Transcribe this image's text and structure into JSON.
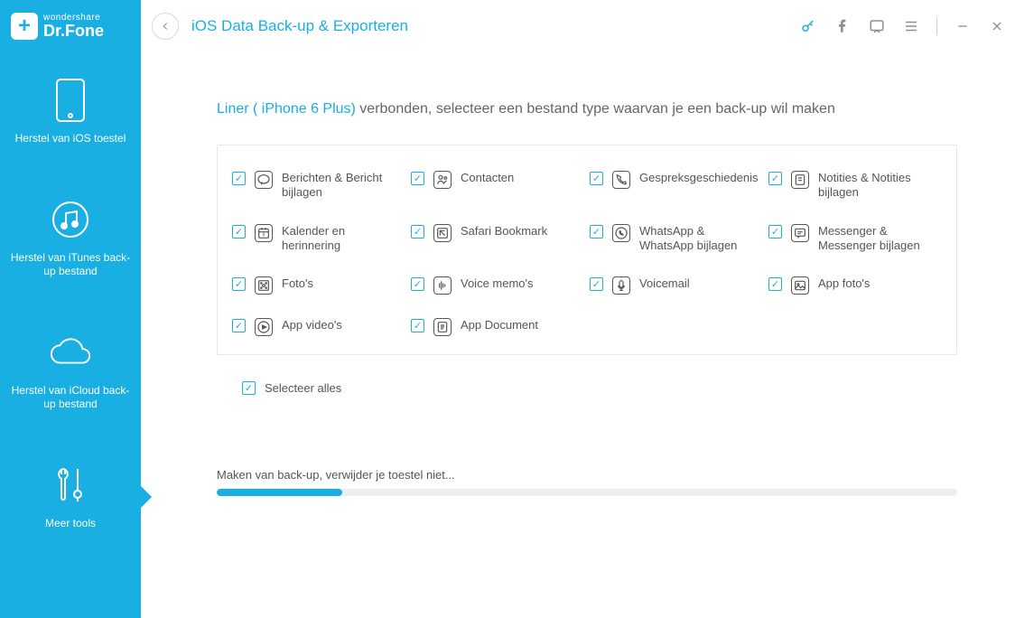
{
  "brand": {
    "top": "wondershare",
    "bottom": "Dr.Fone"
  },
  "page_title": "iOS Data Back-up & Exporteren",
  "device_name": "Liner ( iPhone 6 Plus)",
  "description_suffix": " verbonden, selecteer een bestand type waarvan je een back-up wil maken",
  "sidebar": {
    "items": [
      {
        "label": "Herstel van iOS toestel"
      },
      {
        "label": "Herstel van iTunes back-up bestand"
      },
      {
        "label": "Herstel van iCloud back-up bestand"
      },
      {
        "label": "Meer tools"
      }
    ]
  },
  "options": [
    {
      "label": "Berichten & Bericht bijlagen",
      "icon": "chat"
    },
    {
      "label": "Contacten",
      "icon": "contacts"
    },
    {
      "label": "Gespreksgeschiedenis",
      "icon": "callhistory"
    },
    {
      "label": "Notities & Notities bijlagen",
      "icon": "notes"
    },
    {
      "label": "Kalender en herinnering",
      "icon": "calendar"
    },
    {
      "label": "Safari Bookmark",
      "icon": "safari"
    },
    {
      "label": "WhatsApp & WhatsApp bijlagen",
      "icon": "whatsapp"
    },
    {
      "label": "Messenger & Messenger bijlagen",
      "icon": "messenger"
    },
    {
      "label": "Foto's",
      "icon": "photos"
    },
    {
      "label": "Voice memo's",
      "icon": "voice"
    },
    {
      "label": "Voicemail",
      "icon": "voicemail"
    },
    {
      "label": "App foto's",
      "icon": "appphotos"
    },
    {
      "label": "App video's",
      "icon": "appvideos"
    },
    {
      "label": "App Document",
      "icon": "appdoc"
    }
  ],
  "select_all_label": "Selecteer alles",
  "progress": {
    "text": "Maken van back-up, verwijder je toestel niet...",
    "percent": 17
  }
}
